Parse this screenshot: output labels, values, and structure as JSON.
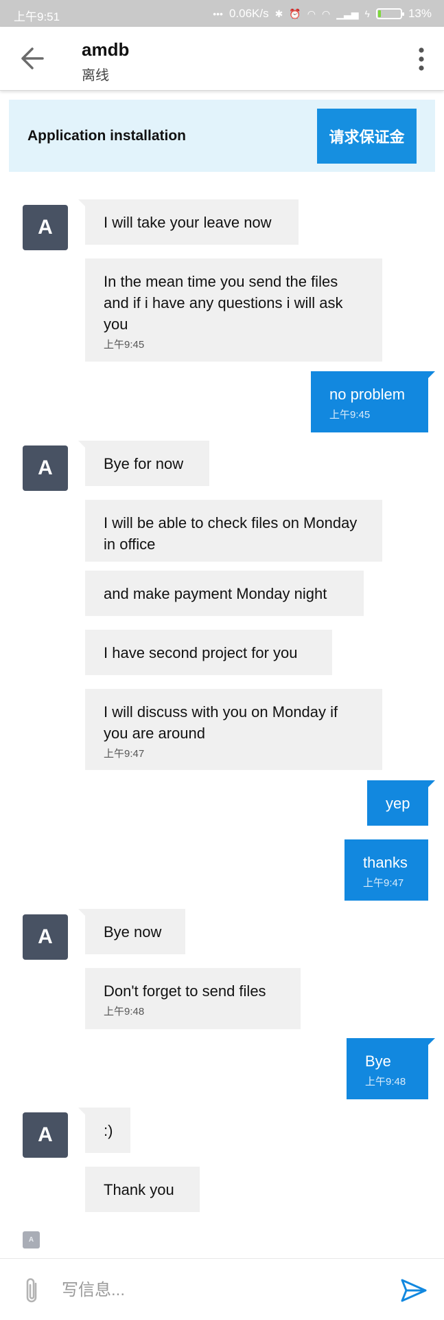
{
  "status_bar": {
    "time": "上午9:51",
    "network_speed": "0.06K/s",
    "battery": "13%",
    "battery_level": 0.13
  },
  "header": {
    "title": "amdb",
    "subtitle": "离线"
  },
  "banner": {
    "text": "Application installation",
    "button_label": "请求保证金"
  },
  "avatar_letter": "A",
  "messages": [
    {
      "dir": "in",
      "text": "I will take your leave now"
    },
    {
      "dir": "in",
      "text": "In the mean time you send the files and if i have any questions i will ask you",
      "time": "上午9:45"
    },
    {
      "dir": "out",
      "text": "no problem",
      "time": "上午9:45"
    },
    {
      "dir": "in",
      "text": "Bye for now"
    },
    {
      "dir": "in",
      "text": "I will be able to check files on Monday in office"
    },
    {
      "dir": "in",
      "text": "and make payment Monday night"
    },
    {
      "dir": "in",
      "text": "I have second project for you"
    },
    {
      "dir": "in",
      "text": "I will discuss with you on Monday if you are around",
      "time": "上午9:47"
    },
    {
      "dir": "out",
      "text": "yep"
    },
    {
      "dir": "out",
      "text": "thanks",
      "time": "上午9:47"
    },
    {
      "dir": "in",
      "text": "Bye now"
    },
    {
      "dir": "in",
      "text": "Don't forget to send files",
      "time": "上午9:48"
    },
    {
      "dir": "out",
      "text": "Bye",
      "time": "上午9:48"
    },
    {
      "dir": "in",
      "text": ":)"
    },
    {
      "dir": "in",
      "text": "Thank you"
    }
  ],
  "composer": {
    "placeholder": "写信息..."
  },
  "colors": {
    "accent": "#1288df",
    "banner_bg": "#e2f3fb",
    "incoming_bubble": "#f0f0f0",
    "avatar": "#485263",
    "status_bar": "#c9c9c9"
  },
  "icons": {
    "back": "arrow-left-icon",
    "menu": "more-vertical-icon",
    "attach": "paperclip-icon",
    "send": "send-icon"
  }
}
